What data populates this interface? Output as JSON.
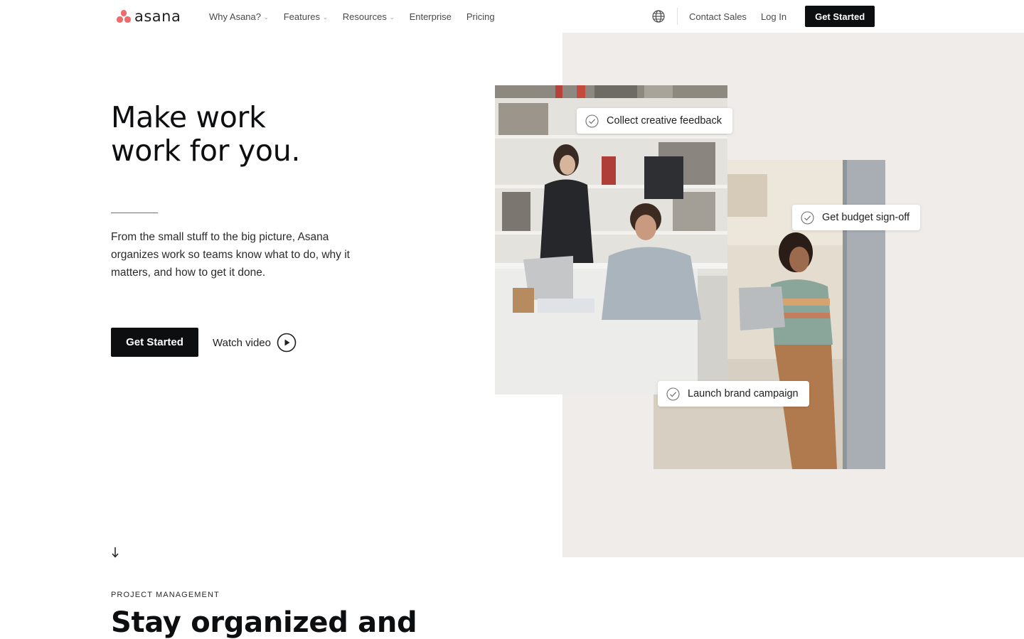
{
  "brand": {
    "name": "asana",
    "accent_color": "#f06a6a"
  },
  "nav": {
    "items": [
      {
        "label": "Why Asana?",
        "has_dropdown": true
      },
      {
        "label": "Features",
        "has_dropdown": true
      },
      {
        "label": "Resources",
        "has_dropdown": true
      },
      {
        "label": "Enterprise",
        "has_dropdown": false
      },
      {
        "label": "Pricing",
        "has_dropdown": false
      }
    ],
    "language_icon": "globe-icon",
    "contact_sales": "Contact Sales",
    "login": "Log In",
    "cta": "Get Started"
  },
  "hero": {
    "title_line1": "Make work",
    "title_line2": "work for you.",
    "subtitle": "From the small stuff to the big picture, Asana organizes work so teams know what to do, why it matters, and how to get it done.",
    "cta": "Get Started",
    "watch_video": "Watch video",
    "tasks": [
      "Collect creative feedback",
      "Get budget sign-off",
      "Launch brand campaign"
    ]
  },
  "scroll_icon": "arrow-down-icon",
  "section": {
    "eyebrow": "PROJECT MANAGEMENT",
    "title": "Stay organized and"
  },
  "colors": {
    "cta_bg": "#0d0e10",
    "hero_panel_bg": "#efecea",
    "text_primary": "#1e1f21"
  }
}
